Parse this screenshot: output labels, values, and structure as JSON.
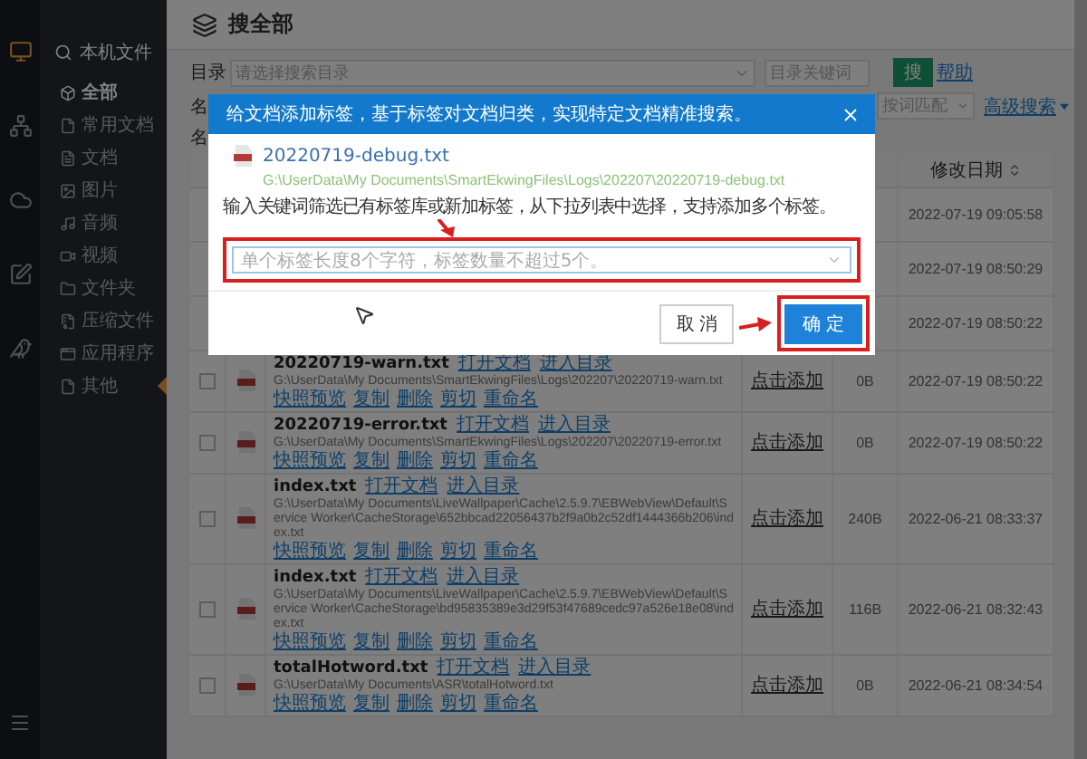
{
  "rail": {
    "items": [
      {
        "kind": "monitor",
        "selected": true
      },
      {
        "kind": "network",
        "selected": false
      },
      {
        "kind": "cloud",
        "selected": false
      },
      {
        "kind": "edit",
        "selected": false
      },
      {
        "kind": "bird",
        "selected": false
      }
    ]
  },
  "sidebar": {
    "heading": "本机文件",
    "items": [
      {
        "kind": "all",
        "label": "全部",
        "selected": true
      },
      {
        "kind": "recent",
        "label": "常用文档",
        "selected": false
      },
      {
        "kind": "document",
        "label": "文档",
        "selected": false
      },
      {
        "kind": "image",
        "label": "图片",
        "selected": false
      },
      {
        "kind": "audio",
        "label": "音频",
        "selected": false
      },
      {
        "kind": "video",
        "label": "视频",
        "selected": false
      },
      {
        "kind": "folder",
        "label": "文件夹",
        "selected": false
      },
      {
        "kind": "archive",
        "label": "压缩文件",
        "selected": false
      },
      {
        "kind": "app",
        "label": "应用程序",
        "selected": false
      },
      {
        "kind": "other",
        "label": "其他",
        "selected": false
      }
    ]
  },
  "page": {
    "title": "搜全部"
  },
  "filters": {
    "directory_label": "目录",
    "directory_placeholder": "请选择搜索目录",
    "keyword_placeholder": "目录关键词",
    "search_button": "搜",
    "help_link": "帮助",
    "name_label": "名",
    "match_mode": "按词匹配",
    "advanced_link": "高级搜索"
  },
  "table": {
    "caption": "名",
    "date_header": "修改日期",
    "rows": [
      {
        "date": "2022-07-19 09:05:58"
      },
      {
        "date": "2022-07-19 08:50:29"
      },
      {
        "date": "2022-07-19 08:50:22"
      },
      {
        "checked": false,
        "name": "20220719-warn.txt",
        "links": [
          "打开文档",
          "进入目录"
        ],
        "path": "G:\\UserData\\My Documents\\SmartEkwingFiles\\Logs\\202207\\20220719-warn.txt",
        "actions": [
          "快照预览",
          "复制",
          "删除",
          "剪切",
          "重命名"
        ],
        "tag": "点击添加",
        "size": "0B",
        "date": "2022-07-19 08:50:22"
      },
      {
        "checked": false,
        "name": "20220719-error.txt",
        "links": [
          "打开文档",
          "进入目录"
        ],
        "path": "G:\\UserData\\My Documents\\SmartEkwingFiles\\Logs\\202207\\20220719-error.txt",
        "actions": [
          "快照预览",
          "复制",
          "删除",
          "剪切",
          "重命名"
        ],
        "tag": "点击添加",
        "size": "0B",
        "date": "2022-07-19 08:50:22"
      },
      {
        "checked": false,
        "name": "index.txt",
        "links": [
          "打开文档",
          "进入目录"
        ],
        "path": "G:\\UserData\\My Documents\\LiveWallpaper\\Cache\\2.5.9.7\\EBWebView\\Default\\Service Worker\\CacheStorage\\652bbcad22056437b2f9a0b2c52df1444366b206\\index.txt",
        "actions": [
          "快照预览",
          "复制",
          "删除",
          "剪切",
          "重命名"
        ],
        "tag": "点击添加",
        "size": "240B",
        "date": "2022-06-21 08:33:37"
      },
      {
        "checked": false,
        "name": "index.txt",
        "links": [
          "打开文档",
          "进入目录"
        ],
        "path": "G:\\UserData\\My Documents\\LiveWallpaper\\Cache\\2.5.9.7\\EBWebView\\Default\\Service Worker\\CacheStorage\\bd95835389e3d29f53f47689cedc97a526e18e08\\index.txt",
        "actions": [
          "快照预览",
          "复制",
          "删除",
          "剪切",
          "重命名"
        ],
        "tag": "点击添加",
        "size": "116B",
        "date": "2022-06-21 08:32:43"
      },
      {
        "checked": false,
        "name": "totalHotword.txt",
        "links": [
          "打开文档",
          "进入目录"
        ],
        "path": "G:\\UserData\\My Documents\\ASR\\totalHotword.txt",
        "actions": [
          "快照预览",
          "复制",
          "删除",
          "剪切",
          "重命名"
        ],
        "tag": "点击添加",
        "size": "0B",
        "date": "2022-06-21 08:34:54"
      }
    ]
  },
  "modal": {
    "title": "给文档添加标签，基于标签对文档归类，实现特定文档精准搜索。",
    "file_name": "20220719-debug.txt",
    "file_path": "G:\\UserData\\My Documents\\SmartEkwingFiles\\Logs\\202207\\20220719-debug.txt",
    "prompt": "输入关键词筛选已有标签库或新加标签，从下拉列表中选择，支持添加多个标签。",
    "tag_placeholder": "单个标签长度8个字符，标签数量不超过5个。",
    "cancel": "取 消",
    "ok": "确 定"
  }
}
